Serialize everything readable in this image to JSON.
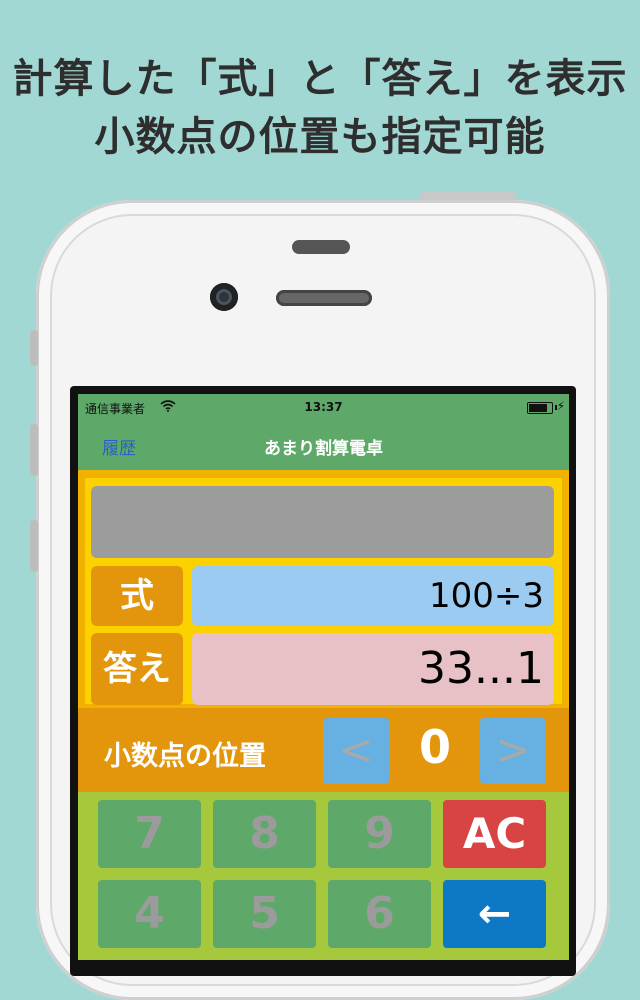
{
  "headline": {
    "line1": "計算した「式」と「答え」を表示",
    "line2": "小数点の位置も指定可能"
  },
  "status_bar": {
    "carrier": "通信事業者",
    "wifi_icon": "wifi-icon",
    "time": "13:37",
    "battery_icon": "battery-icon",
    "charging_symbol": "⚡"
  },
  "nav_bar": {
    "back_label": "履歴",
    "title": "あまり割算電卓"
  },
  "display": {
    "expression_label": "式",
    "expression_value": "100÷3",
    "answer_label": "答え",
    "answer_value": "33...1"
  },
  "decimal": {
    "label": "小数点の位置",
    "decrement": "<",
    "value": "0",
    "increment": ">"
  },
  "keypad": {
    "k7": "7",
    "k8": "8",
    "k9": "9",
    "ac": "AC",
    "k4": "4",
    "k5": "5",
    "k6": "6",
    "backspace": "←"
  },
  "colors": {
    "background": "#a2d8d4",
    "nav_green": "#5ea86a",
    "display_yellow": "#fbd200",
    "orange": "#e3960b",
    "keypad_green": "#a6c83c",
    "ac_red": "#d84444",
    "back_blue": "#0d78c6"
  }
}
